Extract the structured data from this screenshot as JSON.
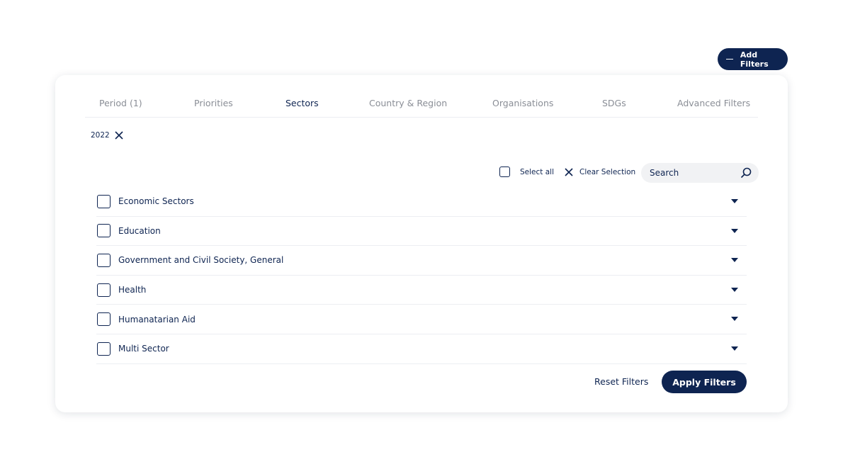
{
  "colors": {
    "primary": "#0e2451",
    "tab_inactive": "#8a8e96",
    "divider": "#eceef2",
    "search_bg": "#f1f2f4"
  },
  "header": {
    "add_filters_label": "Add Filters",
    "add_filters_icon": "minus-icon"
  },
  "tabs": [
    {
      "label": "Period (1)",
      "active": false
    },
    {
      "label": "Priorities",
      "active": false
    },
    {
      "label": "Sectors",
      "active": true
    },
    {
      "label": "Country & Region",
      "active": false
    },
    {
      "label": "Organisations",
      "active": false
    },
    {
      "label": "SDGs",
      "active": false
    },
    {
      "label": "Advanced Filters",
      "active": false
    }
  ],
  "active_filters": [
    {
      "label": "2022",
      "icon": "close-icon"
    }
  ],
  "toolbar": {
    "select_all_label": "Select all",
    "clear_selection_label": "Clear Selection",
    "search_placeholder": "Search",
    "search_value": ""
  },
  "sectors": [
    {
      "label": "Economic Sectors",
      "checked": false
    },
    {
      "label": "Education",
      "checked": false
    },
    {
      "label": "Government and Civil Society, General",
      "checked": false
    },
    {
      "label": "Health",
      "checked": false
    },
    {
      "label": "Humanatarian Aid",
      "checked": false
    },
    {
      "label": "Multi Sector",
      "checked": false
    }
  ],
  "footer": {
    "reset_label": "Reset Filters",
    "apply_label": "Apply Filters"
  }
}
